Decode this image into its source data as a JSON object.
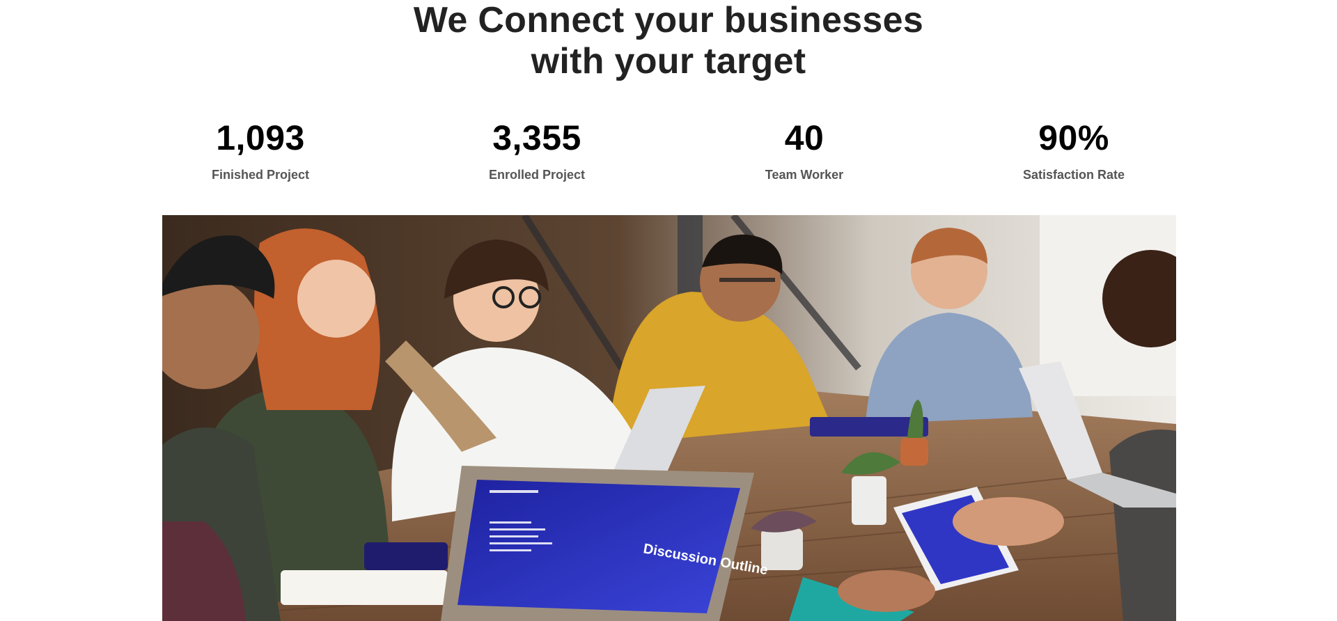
{
  "headline": {
    "line1": "We Connect your businesses",
    "line2": "with your target"
  },
  "stats": [
    {
      "value": "1,093",
      "label": "Finished Project"
    },
    {
      "value": "3,355",
      "label": "Enrolled Project"
    },
    {
      "value": "40",
      "label": "Team Worker"
    },
    {
      "value": "90%",
      "label": "Satisfaction Rate"
    }
  ],
  "photo": {
    "laptop_screen_text": "Discussion Outline"
  },
  "colors": {
    "headline": "#222222",
    "stat_value": "#000000",
    "stat_label": "#555555",
    "table": "#8a6346",
    "screen": "#2a2fb8"
  }
}
